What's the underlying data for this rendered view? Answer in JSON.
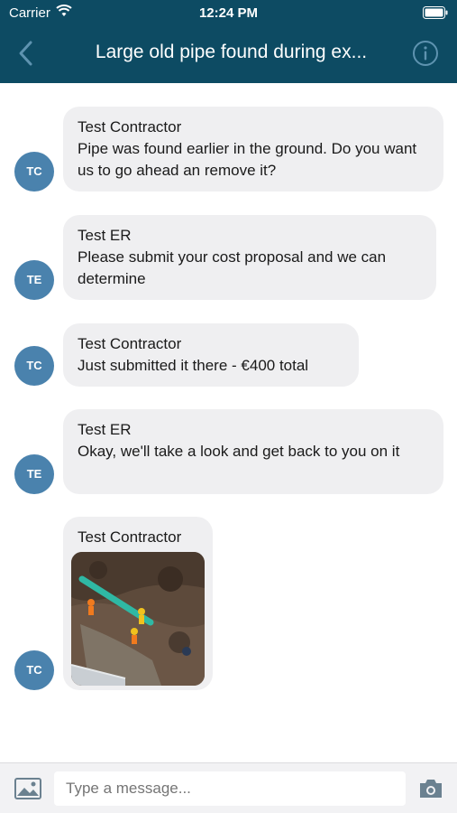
{
  "status_bar": {
    "carrier": "Carrier",
    "time": "12:24 PM"
  },
  "header": {
    "title": "Large old pipe found during ex..."
  },
  "messages": [
    {
      "initials": "TC",
      "sender": "Test Contractor",
      "text": "Pipe was found earlier in the ground. Do you want us to go ahead an remove it?"
    },
    {
      "initials": "TE",
      "sender": "Test ER",
      "text": "Please submit your cost proposal and we can determine"
    },
    {
      "initials": "TC",
      "sender": "Test Contractor",
      "text": "Just submitted it there - €400 total"
    },
    {
      "initials": "TE",
      "sender": "Test ER",
      "text": "Okay, we'll take a look and get back to you on it"
    },
    {
      "initials": "TC",
      "sender": "Test Contractor",
      "text": ""
    }
  ],
  "composer": {
    "placeholder": "Type a message..."
  },
  "colors": {
    "header_bg": "#0d4b63",
    "avatar_bg": "#4a82ad",
    "bubble_bg": "#efeff1"
  }
}
